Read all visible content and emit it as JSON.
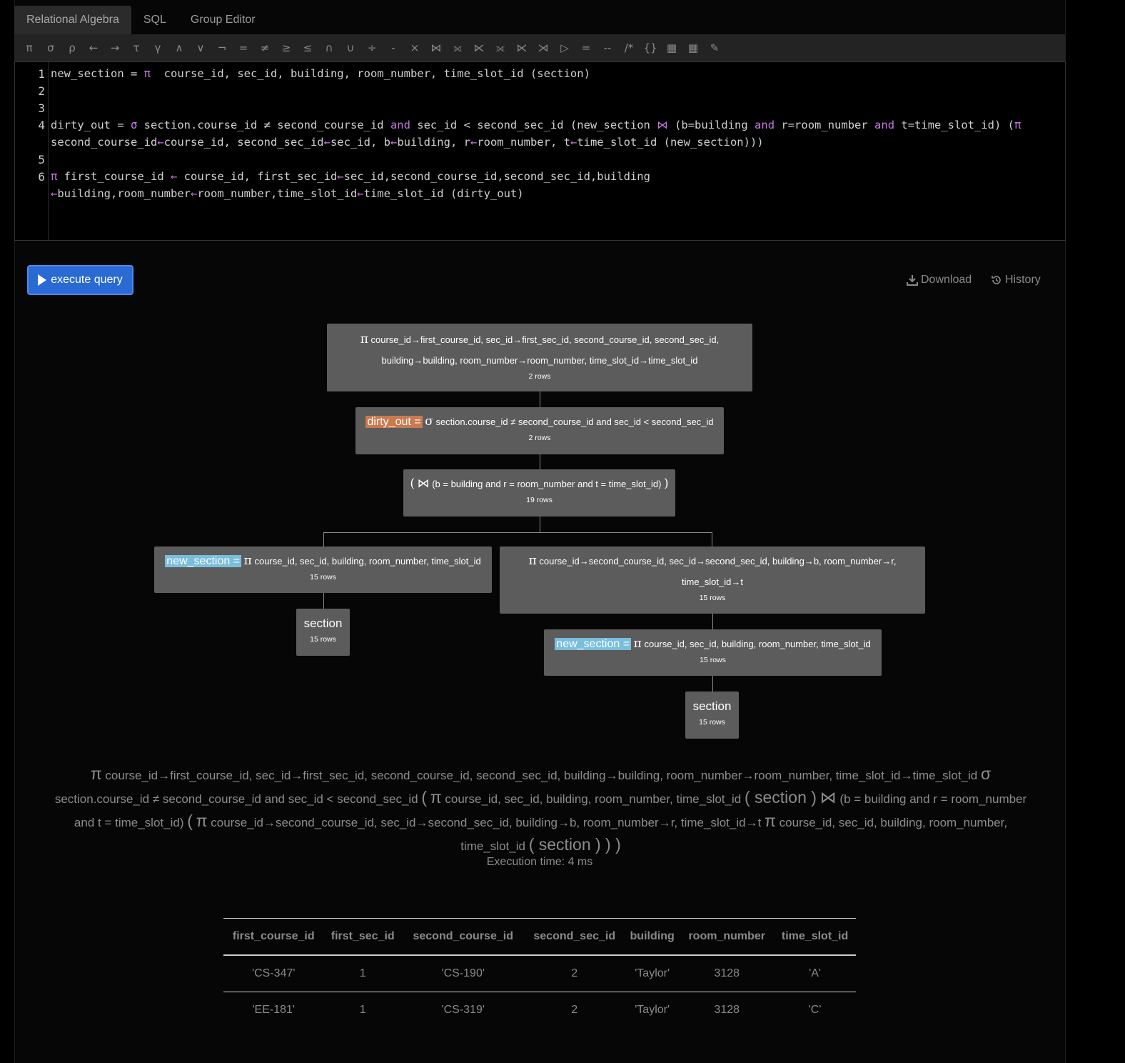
{
  "tabs": [
    "Relational Algebra",
    "SQL",
    "Group Editor"
  ],
  "toolbar": [
    "π",
    "σ",
    "ρ",
    "←",
    "→",
    "τ",
    "γ",
    "∧",
    "∨",
    "¬",
    "=",
    "≠",
    "≥",
    "≤",
    "∩",
    "∪",
    "÷",
    "-",
    "×",
    "⋈",
    "⟗",
    "⋉",
    "⟗",
    "⋉",
    "⋊",
    "▷",
    "=",
    "--",
    "/*",
    "{}",
    "▦",
    "▦",
    "✎"
  ],
  "editor": {
    "line_numbers": [
      "1",
      "2",
      "3",
      "4",
      "5",
      "6"
    ],
    "line1": {
      "name": "new_section = ",
      "op": "π",
      "rest": "  course_id, sec_id, building, room_number, time_slot_id (section)"
    },
    "line4a": {
      "p1": "dirty_out = ",
      "op": "σ",
      "p2": " section.course_id ≠ second_course_id ",
      "and1": "and",
      "p3": " sec_id < second_sec_id (new_section ",
      "join": "⋈",
      "p4": " (b=building ",
      "and2": "and",
      "p5": " r=room_number ",
      "and3": "and",
      "p6": " t=time_slot_id) (",
      "pi": "π"
    },
    "line4b": {
      "p1": "second_course_id",
      "a1": "←",
      "p2": "course_id, second_sec_id",
      "a2": "←",
      "p3": "sec_id, b",
      "a3": "←",
      "p4": "building, r",
      "a4": "←",
      "p5": "room_number, t",
      "a5": "←",
      "p6": "time_slot_id (new_section)))"
    },
    "line6a": {
      "pi": "π",
      "p1": " first_course_id ",
      "a1": "←",
      "p2": " course_id, first_sec_id",
      "a2": "←",
      "p3": "sec_id,second_course_id,second_sec_id,building"
    },
    "line6b": {
      "a1": "←",
      "p1": "building,room_number",
      "a2": "←",
      "p2": "room_number,time_slot_id",
      "a3": "←",
      "p3": "time_slot_id (dirty_out)"
    }
  },
  "execute_label": "execute query",
  "download_label": "Download",
  "history_label": "History",
  "tree": {
    "root": {
      "sym": "π",
      "line1": "course_id→first_course_id, sec_id→first_sec_id, second_course_id, second_sec_id,",
      "line2": "building→building, room_number→room_number, time_slot_id→time_slot_id",
      "rows": "2 rows"
    },
    "select": {
      "alias": "dirty_out =",
      "sym": "σ",
      "text": "section.course_id ≠ second_course_id and sec_id < second_sec_id",
      "rows": "2 rows"
    },
    "join": {
      "open": "(",
      "sym": "⋈",
      "text": "(b = building and r = room_number and t = time_slot_id)",
      "close": ")",
      "rows": "19 rows"
    },
    "proj_left": {
      "alias": "new_section =",
      "sym": "π",
      "text": "course_id, sec_id, building, room_number, time_slot_id",
      "rows": "15 rows"
    },
    "section_left": {
      "name": "section",
      "rows": "15 rows"
    },
    "proj_right": {
      "sym": "π",
      "line1": "course_id→second_course_id, sec_id→second_sec_id, building→b, room_number→r,",
      "line2": "time_slot_id→t",
      "rows": "15 rows"
    },
    "proj_right_child": {
      "alias": "new_section =",
      "sym": "π",
      "text": "course_id, sec_id, building, room_number, time_slot_id",
      "rows": "15 rows"
    },
    "section_right": {
      "name": "section",
      "rows": "15 rows"
    }
  },
  "expression": {
    "s1": "π",
    "t1": "course_id→first_course_id, sec_id→first_sec_id, second_course_id, second_sec_id, building→building, room_number→room_number, time_slot_id→time_slot_id",
    "s2": "σ",
    "t2": "section.course_id ≠ second_course_id and sec_id < second_sec_id",
    "p1": "(",
    "s3": "π",
    "t3": "course_id, sec_id, building, room_number, time_slot_id",
    "p2": "( section )",
    "s4": "⋈",
    "t4": "(b = building and r = room_number",
    "t5": "and t = time_slot_id)",
    "p3": "(",
    "s5": "π",
    "t6": "course_id→second_course_id, sec_id→second_sec_id, building→b, room_number→r, time_slot_id→t",
    "s6": "π",
    "t7": "course_id, sec_id, building, room_number,",
    "t8": "time_slot_id",
    "p4": "( section ) ) )"
  },
  "execution_time": "Execution time: 4 ms",
  "table": {
    "headers": [
      "first_course_id",
      "first_sec_id",
      "second_course_id",
      "second_sec_id",
      "building",
      "room_number",
      "time_slot_id"
    ],
    "rows": [
      [
        "'CS-347'",
        "1",
        "'CS-190'",
        "2",
        "'Taylor'",
        "3128",
        "'A'"
      ],
      [
        "'EE-181'",
        "1",
        "'CS-319'",
        "2",
        "'Taylor'",
        "3128",
        "'C'"
      ]
    ]
  }
}
